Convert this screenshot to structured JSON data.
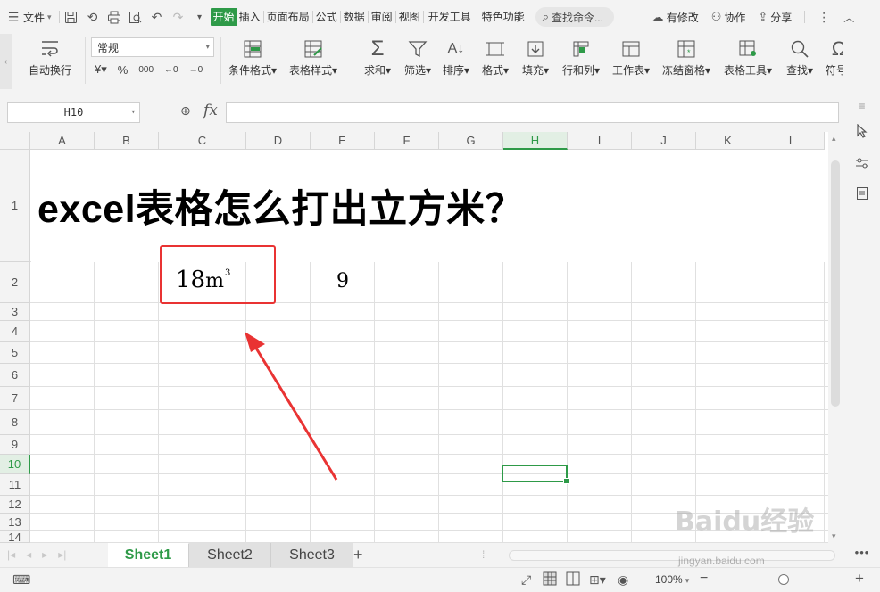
{
  "menubar": {
    "file_label": "文件",
    "tabs": [
      "开始",
      "插入",
      "页面布局",
      "公式",
      "数据",
      "审阅",
      "视图",
      "开发工具",
      "特色功能"
    ],
    "active_tab": "开始",
    "search_label": "查找命令...",
    "has_changes_label": "有修改",
    "collab_label": "协作",
    "share_label": "分享"
  },
  "ribbon": {
    "wrap_label": "自动换行",
    "number_format": "常规",
    "conditional_format_label": "条件格式",
    "table_style_label": "表格样式",
    "sum_label": "求和",
    "filter_label": "筛选",
    "sort_label": "排序",
    "format_label": "格式",
    "fill_label": "填充",
    "rowcol_label": "行和列",
    "worksheet_label": "工作表",
    "freeze_label": "冻结窗格",
    "tabletools_label": "表格工具",
    "find_label": "查找",
    "symbol_label": "符号"
  },
  "formula": {
    "cell_ref": "H10",
    "fx_label": "fx",
    "value": ""
  },
  "grid": {
    "columns": [
      "A",
      "B",
      "C",
      "D",
      "E",
      "F",
      "G",
      "H",
      "I",
      "J",
      "K",
      "L"
    ],
    "rows": [
      "1",
      "2",
      "3",
      "4",
      "5",
      "6",
      "7",
      "8",
      "9",
      "10",
      "11",
      "12",
      "13",
      "14"
    ],
    "selected_column": "H",
    "selected_row": "10",
    "title": "excel表格怎么打出立方米？",
    "c2_value": "18",
    "c2_unit": "m",
    "c2_superscript": "3",
    "e2_value": "9"
  },
  "sheets": {
    "tabs": [
      "Sheet1",
      "Sheet2",
      "Sheet3"
    ],
    "active": "Sheet1",
    "add_label": "+"
  },
  "status": {
    "zoom_label": "100%",
    "minus_label": "−",
    "plus_label": "+"
  },
  "watermark": {
    "brand": "Baidu经验",
    "url": "jingyan.baidu.com"
  },
  "colors": {
    "accent": "#2e9a48",
    "annotation": "#e93333"
  }
}
